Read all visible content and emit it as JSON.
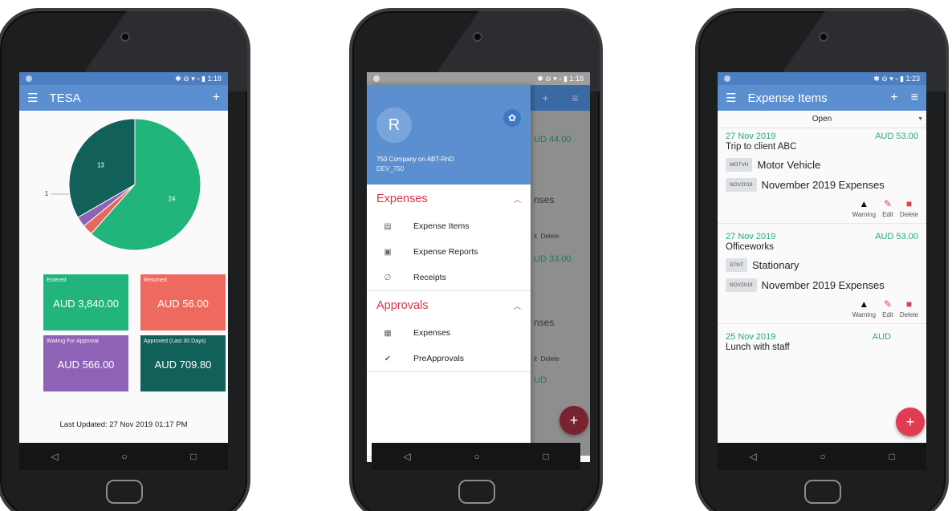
{
  "phone1": {
    "status_time": "1:18",
    "app_title": "TESA",
    "pie": {
      "values": [
        24,
        1,
        1,
        13
      ],
      "labels": [
        "24",
        "1",
        "1",
        "13"
      ],
      "colors": [
        "#21b57c",
        "#e8675c",
        "#8e63b6",
        "#12605a"
      ]
    },
    "tiles": [
      {
        "label": "Entered",
        "value": "AUD 3,840.00",
        "color": "#21b57c"
      },
      {
        "label": "Returned",
        "value": "AUD 56.00",
        "color": "#ee6a5e"
      },
      {
        "label": "Waiting For Approval",
        "value": "AUD 566.00",
        "color": "#8e63b6"
      },
      {
        "label": "Approved (Last 30 Days)",
        "value": "AUD 709.80",
        "color": "#12605a"
      }
    ],
    "last_updated": "Last Updated: 27 Nov 2019 01:17 PM"
  },
  "phone2": {
    "status_time": "1:18",
    "avatar_letter": "R",
    "company": "750 Company on ABT-RnD",
    "dev": "DEV_750",
    "sections": [
      {
        "title": "Expenses",
        "items": [
          "Expense Items",
          "Expense Reports",
          "Receipts"
        ]
      },
      {
        "title": "Approvals",
        "items": [
          "Expenses",
          "PreApprovals"
        ]
      }
    ],
    "behind": {
      "amount1": "UD 44.00",
      "amount2": "UD 33.00",
      "amount3": "UD",
      "text1": "nses",
      "text2": "nses",
      "dl": "Delete",
      "ed": "it"
    }
  },
  "phone3": {
    "status_time": "1:23",
    "app_title": "Expense Items",
    "filter": "Open",
    "items": [
      {
        "date": "27 Nov 2019",
        "amount": "AUD 53.00",
        "desc": "Trip to client ABC",
        "tag1": "MOTVH",
        "tag1_text": "Motor Vehicle",
        "tag2": "NOV2019",
        "tag2_text": "November 2019 Expenses"
      },
      {
        "date": "27 Nov 2019",
        "amount": "AUD 53.00",
        "desc": "Officeworks",
        "tag1": "STNT",
        "tag1_text": "Stationary",
        "tag2": "NOV2019",
        "tag2_text": "November 2019 Expenses"
      },
      {
        "date": "25 Nov 2019",
        "amount": "AUD",
        "desc": "Lunch with staff"
      }
    ],
    "actions": [
      "Warning",
      "Edit",
      "Delete"
    ]
  },
  "nav": {
    "back": "◁",
    "home": "○",
    "recent": "□"
  },
  "colors": {
    "appbar": "#5b8fd0",
    "accent": "#e23c52",
    "green": "#2aa872"
  }
}
